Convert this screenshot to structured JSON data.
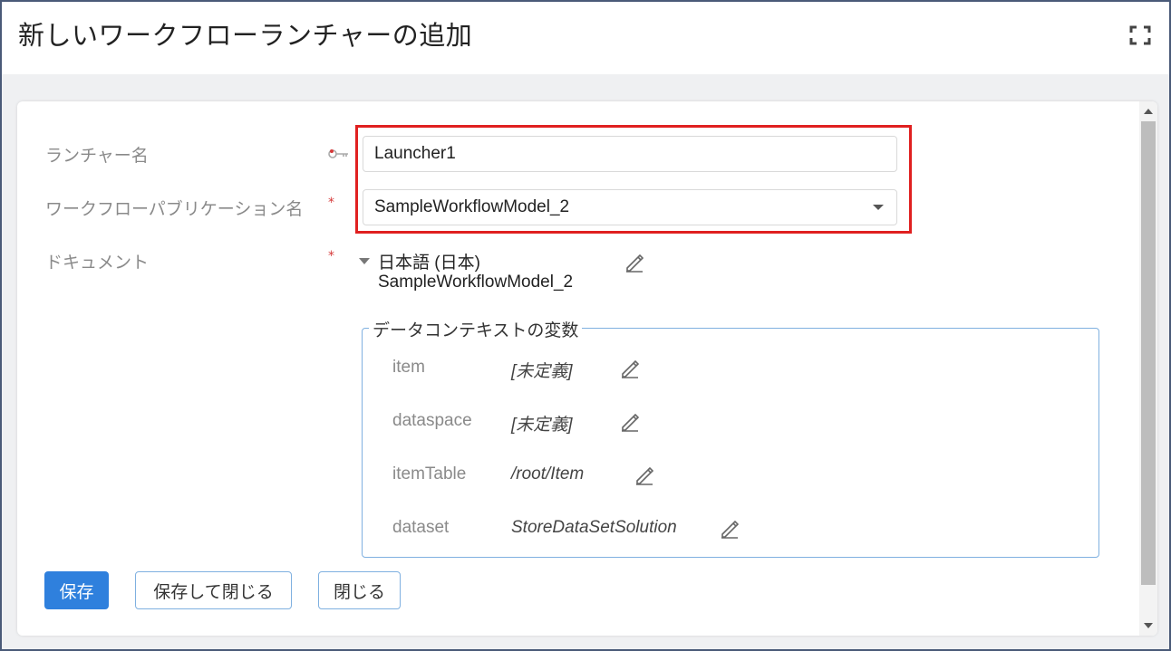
{
  "window": {
    "title": "新しいワークフローランチャーの追加"
  },
  "form": {
    "launcher_name_label": "ランチャー名",
    "launcher_name_value": "Launcher1",
    "publication_label": "ワークフローパブリケーション名",
    "publication_value": "SampleWorkflowModel_2",
    "document_label": "ドキュメント",
    "required_mark": "*",
    "document_language": "日本語 (日本)",
    "document_value": "SampleWorkflowModel_2"
  },
  "data_context": {
    "legend": "データコンテキストの変数",
    "variables": [
      {
        "name": "item",
        "value": "[未定義]"
      },
      {
        "name": "dataspace",
        "value": "[未定義]"
      },
      {
        "name": "itemTable",
        "value": "/root/Item"
      },
      {
        "name": "dataset",
        "value": "StoreDataSetSolution"
      }
    ]
  },
  "buttons": {
    "save": "保存",
    "save_and_close": "保存して閉じる",
    "close": "閉じる"
  },
  "colors": {
    "primary": "#2f80dd",
    "required": "#d63a3a",
    "highlight": "#e02020",
    "fieldset_border": "#7fb0e0"
  },
  "icons": {
    "fullscreen": "fullscreen-icon",
    "key": "key-icon",
    "edit": "pencil-icon"
  }
}
